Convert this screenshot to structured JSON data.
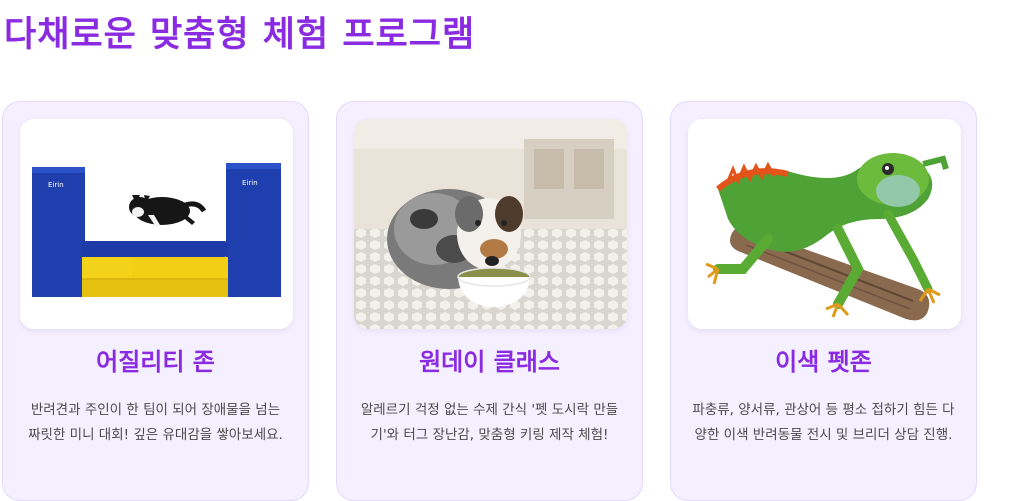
{
  "page": {
    "title": "다채로운 맞춤형 체험 프로그램"
  },
  "cards": [
    {
      "title": "어질리티 존",
      "description": "반려견과 주인이 한 팀이 되어 장애물을 넘는 짜릿한 미니 대회! 깊은 유대감을 쌓아보세요.",
      "image": "agility-dog-jump-image",
      "logo_text": "Eirin"
    },
    {
      "title": "원데이 클래스",
      "description": "알레르기 걱정 없는 수제 간식 '펫 도시락 만들기'와 터그 장난감, 맞춤형 키링 제작 체험!",
      "image": "dog-eating-bowl-image"
    },
    {
      "title": "이색 펫존",
      "description": "파충류, 양서류, 관상어 등 평소 접하기 힘든 다양한 이색 반려동물 전시 및 브리더 상담 진행.",
      "image": "iguana-image"
    }
  ],
  "colors": {
    "accent": "#8a2be2",
    "card_bg": "#f5f0ff",
    "card_border": "#e4d8fb",
    "text": "#4a4a4a"
  }
}
